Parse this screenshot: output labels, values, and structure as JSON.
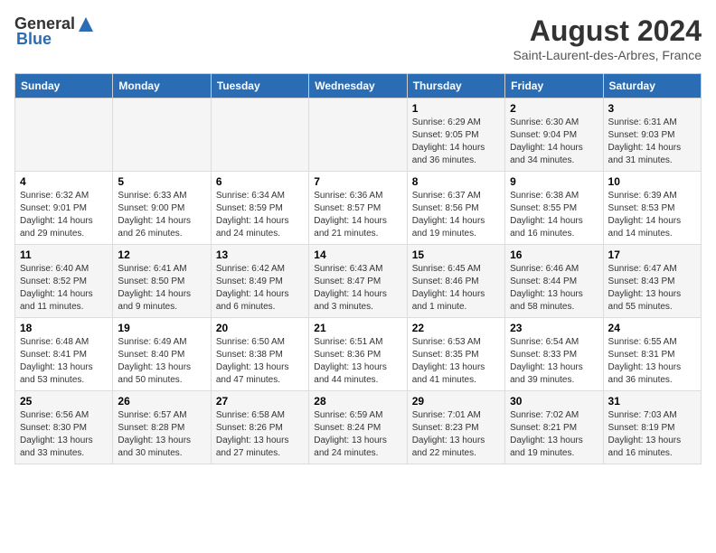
{
  "logo": {
    "general": "General",
    "blue": "Blue"
  },
  "title": "August 2024",
  "subtitle": "Saint-Laurent-des-Arbres, France",
  "days_of_week": [
    "Sunday",
    "Monday",
    "Tuesday",
    "Wednesday",
    "Thursday",
    "Friday",
    "Saturday"
  ],
  "weeks": [
    [
      {
        "day": "",
        "info": ""
      },
      {
        "day": "",
        "info": ""
      },
      {
        "day": "",
        "info": ""
      },
      {
        "day": "",
        "info": ""
      },
      {
        "day": "1",
        "info": "Sunrise: 6:29 AM\nSunset: 9:05 PM\nDaylight: 14 hours and 36 minutes."
      },
      {
        "day": "2",
        "info": "Sunrise: 6:30 AM\nSunset: 9:04 PM\nDaylight: 14 hours and 34 minutes."
      },
      {
        "day": "3",
        "info": "Sunrise: 6:31 AM\nSunset: 9:03 PM\nDaylight: 14 hours and 31 minutes."
      }
    ],
    [
      {
        "day": "4",
        "info": "Sunrise: 6:32 AM\nSunset: 9:01 PM\nDaylight: 14 hours and 29 minutes."
      },
      {
        "day": "5",
        "info": "Sunrise: 6:33 AM\nSunset: 9:00 PM\nDaylight: 14 hours and 26 minutes."
      },
      {
        "day": "6",
        "info": "Sunrise: 6:34 AM\nSunset: 8:59 PM\nDaylight: 14 hours and 24 minutes."
      },
      {
        "day": "7",
        "info": "Sunrise: 6:36 AM\nSunset: 8:57 PM\nDaylight: 14 hours and 21 minutes."
      },
      {
        "day": "8",
        "info": "Sunrise: 6:37 AM\nSunset: 8:56 PM\nDaylight: 14 hours and 19 minutes."
      },
      {
        "day": "9",
        "info": "Sunrise: 6:38 AM\nSunset: 8:55 PM\nDaylight: 14 hours and 16 minutes."
      },
      {
        "day": "10",
        "info": "Sunrise: 6:39 AM\nSunset: 8:53 PM\nDaylight: 14 hours and 14 minutes."
      }
    ],
    [
      {
        "day": "11",
        "info": "Sunrise: 6:40 AM\nSunset: 8:52 PM\nDaylight: 14 hours and 11 minutes."
      },
      {
        "day": "12",
        "info": "Sunrise: 6:41 AM\nSunset: 8:50 PM\nDaylight: 14 hours and 9 minutes."
      },
      {
        "day": "13",
        "info": "Sunrise: 6:42 AM\nSunset: 8:49 PM\nDaylight: 14 hours and 6 minutes."
      },
      {
        "day": "14",
        "info": "Sunrise: 6:43 AM\nSunset: 8:47 PM\nDaylight: 14 hours and 3 minutes."
      },
      {
        "day": "15",
        "info": "Sunrise: 6:45 AM\nSunset: 8:46 PM\nDaylight: 14 hours and 1 minute."
      },
      {
        "day": "16",
        "info": "Sunrise: 6:46 AM\nSunset: 8:44 PM\nDaylight: 13 hours and 58 minutes."
      },
      {
        "day": "17",
        "info": "Sunrise: 6:47 AM\nSunset: 8:43 PM\nDaylight: 13 hours and 55 minutes."
      }
    ],
    [
      {
        "day": "18",
        "info": "Sunrise: 6:48 AM\nSunset: 8:41 PM\nDaylight: 13 hours and 53 minutes."
      },
      {
        "day": "19",
        "info": "Sunrise: 6:49 AM\nSunset: 8:40 PM\nDaylight: 13 hours and 50 minutes."
      },
      {
        "day": "20",
        "info": "Sunrise: 6:50 AM\nSunset: 8:38 PM\nDaylight: 13 hours and 47 minutes."
      },
      {
        "day": "21",
        "info": "Sunrise: 6:51 AM\nSunset: 8:36 PM\nDaylight: 13 hours and 44 minutes."
      },
      {
        "day": "22",
        "info": "Sunrise: 6:53 AM\nSunset: 8:35 PM\nDaylight: 13 hours and 41 minutes."
      },
      {
        "day": "23",
        "info": "Sunrise: 6:54 AM\nSunset: 8:33 PM\nDaylight: 13 hours and 39 minutes."
      },
      {
        "day": "24",
        "info": "Sunrise: 6:55 AM\nSunset: 8:31 PM\nDaylight: 13 hours and 36 minutes."
      }
    ],
    [
      {
        "day": "25",
        "info": "Sunrise: 6:56 AM\nSunset: 8:30 PM\nDaylight: 13 hours and 33 minutes."
      },
      {
        "day": "26",
        "info": "Sunrise: 6:57 AM\nSunset: 8:28 PM\nDaylight: 13 hours and 30 minutes."
      },
      {
        "day": "27",
        "info": "Sunrise: 6:58 AM\nSunset: 8:26 PM\nDaylight: 13 hours and 27 minutes."
      },
      {
        "day": "28",
        "info": "Sunrise: 6:59 AM\nSunset: 8:24 PM\nDaylight: 13 hours and 24 minutes."
      },
      {
        "day": "29",
        "info": "Sunrise: 7:01 AM\nSunset: 8:23 PM\nDaylight: 13 hours and 22 minutes."
      },
      {
        "day": "30",
        "info": "Sunrise: 7:02 AM\nSunset: 8:21 PM\nDaylight: 13 hours and 19 minutes."
      },
      {
        "day": "31",
        "info": "Sunrise: 7:03 AM\nSunset: 8:19 PM\nDaylight: 13 hours and 16 minutes."
      }
    ]
  ]
}
